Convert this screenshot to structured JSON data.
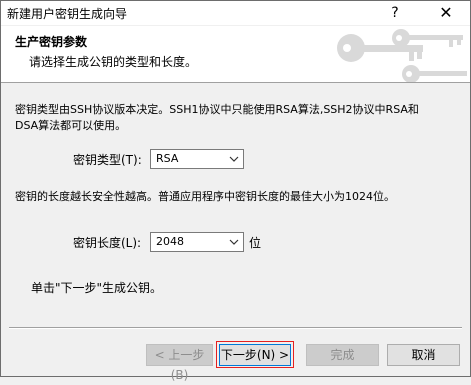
{
  "window": {
    "title": "新建用户密钥生成向导",
    "help_label": "?",
    "close_label": "✕"
  },
  "header": {
    "title": "生产密钥参数",
    "subtitle": "请选择生成公钥的类型和长度。"
  },
  "main": {
    "intro_line1": "密钥类型由SSH协议版本决定。SSH1协议中只能使用RSA算法,SSH2协议中RSA和",
    "intro_line2": "DSA算法都可以使用。",
    "key_type_label": "密钥类型(T):",
    "key_type_value": "RSA",
    "length_note": "密钥的长度越长安全性越高。普通应用程序中密钥长度的最佳大小为1024位。",
    "key_length_label": "密钥长度(L):",
    "key_length_value": "2048",
    "key_length_unit": "位",
    "footer_note": "单击\"下一步\"生成公钥。"
  },
  "buttons": {
    "back": "< 上一步(B)",
    "next": "下一步(N) >",
    "finish": "完成",
    "cancel": "取消"
  },
  "icons": {
    "dropdown": "chevron-down-icon",
    "header_art": "keys-icon"
  }
}
